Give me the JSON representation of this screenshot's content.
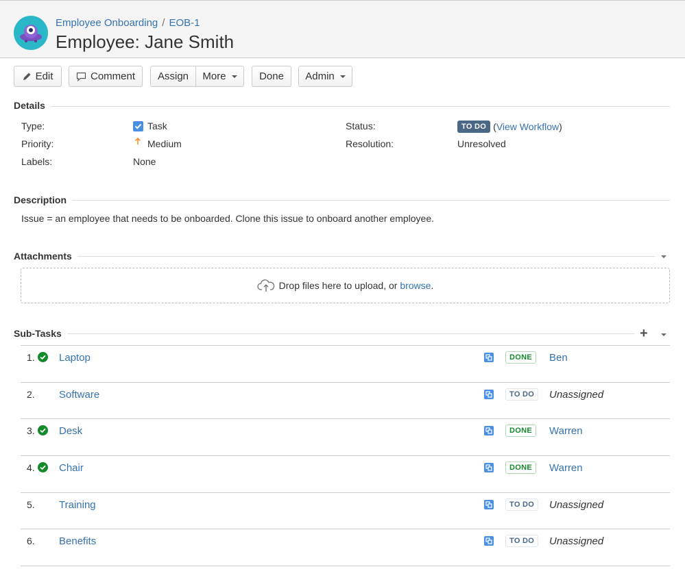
{
  "header": {
    "project": "Employee Onboarding",
    "separator": "/",
    "issue_key": "EOB-1",
    "title": "Employee: Jane Smith"
  },
  "toolbar": {
    "edit": "Edit",
    "comment": "Comment",
    "assign": "Assign",
    "more": "More",
    "done": "Done",
    "admin": "Admin"
  },
  "details": {
    "heading": "Details",
    "type_label": "Type:",
    "type_value": "Task",
    "priority_label": "Priority:",
    "priority_value": "Medium",
    "labels_label": "Labels:",
    "labels_value": "None",
    "status_label": "Status:",
    "status_value": "TO DO",
    "view_workflow_open": "(",
    "view_workflow": "View Workflow",
    "view_workflow_close": ")",
    "resolution_label": "Resolution:",
    "resolution_value": "Unresolved"
  },
  "description": {
    "heading": "Description",
    "text": "Issue = an employee that needs to be onboarded. Clone this issue to onboard another employee."
  },
  "attachments": {
    "heading": "Attachments",
    "drop_text": "Drop files here to upload, or",
    "browse": "browse",
    "period": "."
  },
  "subtasks": {
    "heading": "Sub-Tasks",
    "add": "+",
    "rows": [
      {
        "num": "1.",
        "title": "Laptop",
        "status": "DONE",
        "assignee": "Ben",
        "done": true
      },
      {
        "num": "2.",
        "title": "Software",
        "status": "TO DO",
        "assignee": "Unassigned",
        "done": false
      },
      {
        "num": "3.",
        "title": "Desk",
        "status": "DONE",
        "assignee": "Warren",
        "done": true
      },
      {
        "num": "4.",
        "title": "Chair",
        "status": "DONE",
        "assignee": "Warren",
        "done": true
      },
      {
        "num": "5.",
        "title": "Training",
        "status": "TO DO",
        "assignee": "Unassigned",
        "done": false
      },
      {
        "num": "6.",
        "title": "Benefits",
        "status": "TO DO",
        "assignee": "Unassigned",
        "done": false
      }
    ]
  },
  "colors": {
    "link": "#3572b0",
    "done_green": "#14892c",
    "todo_blue": "#4a6785",
    "avatar_teal": "#2ab7c7",
    "avatar_purple": "#7a4fbf"
  }
}
